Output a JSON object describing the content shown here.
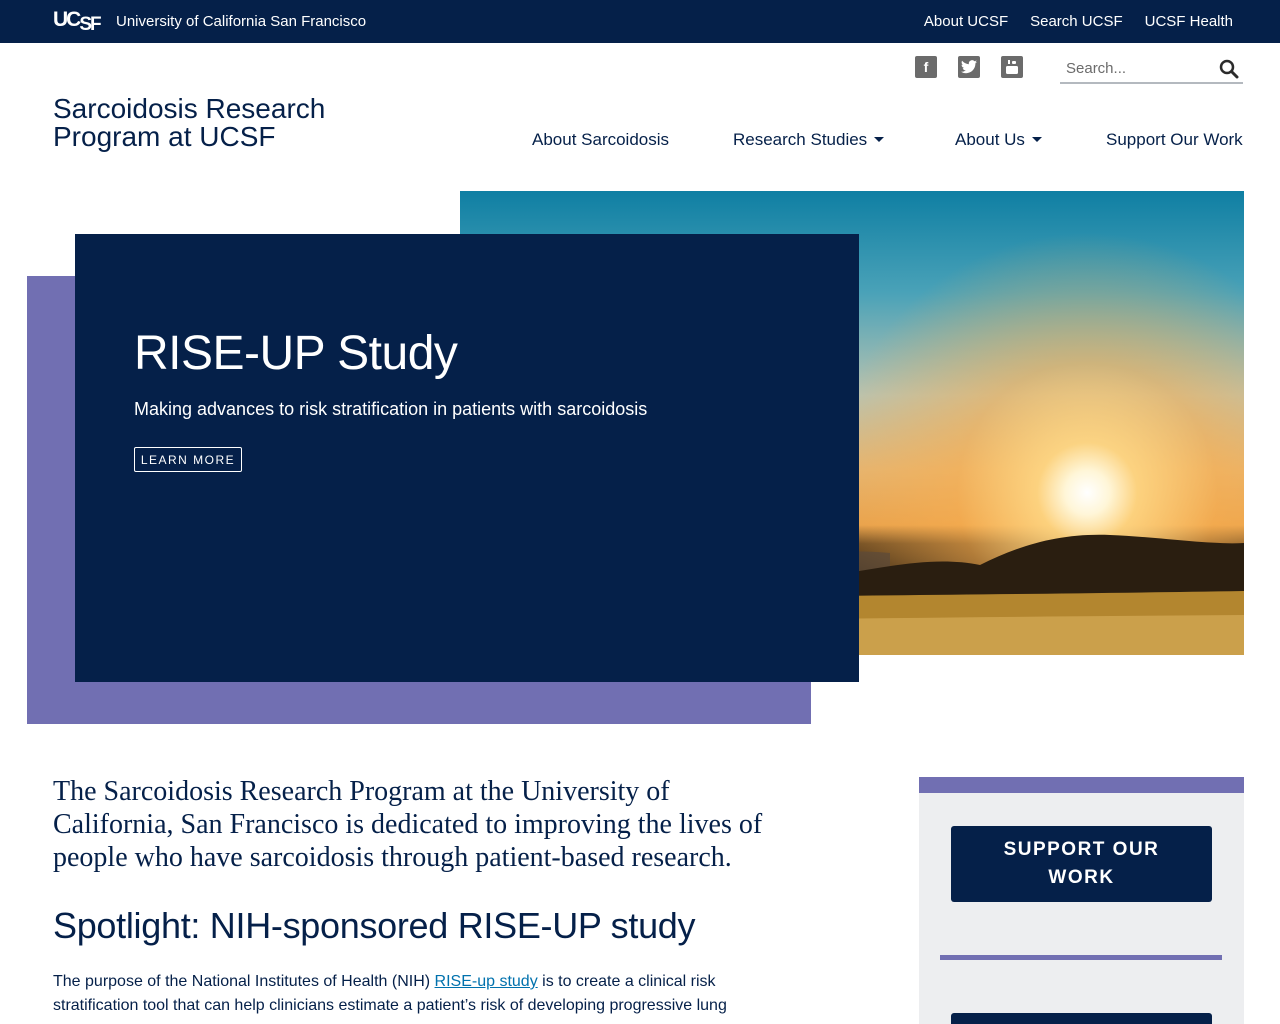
{
  "topbar": {
    "logo": "UCSF",
    "logo_main": "UC",
    "logo_sf": "SF",
    "university": "University of California San Francisco",
    "links": [
      "About UCSF",
      "Search UCSF",
      "UCSF Health"
    ]
  },
  "header": {
    "site_title_line1": "Sarcoidosis Research",
    "site_title_line2": "Program at UCSF",
    "social": [
      "facebook-icon",
      "twitter-icon",
      "youtube-icon"
    ],
    "search_placeholder": "Search..."
  },
  "nav": {
    "items": [
      {
        "label": "About Sarcoidosis",
        "dropdown": false
      },
      {
        "label": "Research Studies",
        "dropdown": true
      },
      {
        "label": "About Us",
        "dropdown": true
      },
      {
        "label": "Support Our Work",
        "dropdown": false
      }
    ]
  },
  "hero": {
    "title": "RISE-UP Study",
    "subtitle": "Making advances to risk stratification in patients with sarcoidosis",
    "button": "LEARN MORE"
  },
  "content": {
    "intro": "The Sarcoidosis Research Program at the University of California, San Francisco is dedicated to improving the lives of people who have sarcoidosis through patient-based research.",
    "spotlight_heading": "Spotlight: NIH-sponsored RISE-UP study",
    "para_before_link": "The purpose of the National Institutes of Health (NIH) ",
    "para_link": "RISE-up study",
    "para_after_link": " is to create a clinical risk stratification tool that can help clinicians estimate a patient’s risk of developing progressive lung"
  },
  "sidebar": {
    "button_line1": "SUPPORT OUR",
    "button_line2": "WORK"
  },
  "colors": {
    "navy": "#052049",
    "purple": "#716fb2",
    "link": "#0071ad",
    "sidebar_bg": "#edeef0"
  }
}
